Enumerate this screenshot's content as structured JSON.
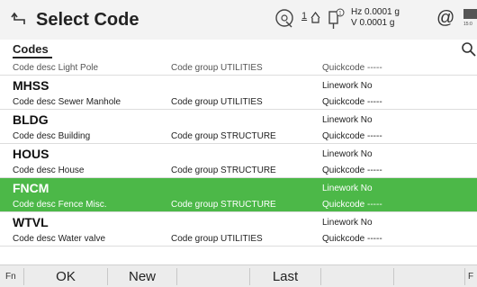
{
  "header": {
    "title": "Select Code",
    "target_label": "1",
    "hz_text": "Hz 0.0001 g",
    "v_text": "V  0.0001 g",
    "at_symbol": "@",
    "status_label": "15:0"
  },
  "tab": {
    "label": "Codes"
  },
  "rows": [
    {
      "code": "",
      "desc": "Code desc  Light Pole",
      "group": "Code group  UTILITIES",
      "linework": "",
      "quickcode": "Quickcode  -----"
    },
    {
      "code": "MHSS",
      "desc": "Code desc  Sewer Manhole",
      "group": "Code group  UTILITIES",
      "linework": "Linework  No",
      "quickcode": "Quickcode  -----"
    },
    {
      "code": "BLDG",
      "desc": "Code desc  Building",
      "group": "Code group  STRUCTURE",
      "linework": "Linework  No",
      "quickcode": "Quickcode  -----"
    },
    {
      "code": "HOUS",
      "desc": "Code desc  House",
      "group": "Code group  STRUCTURE",
      "linework": "Linework  No",
      "quickcode": "Quickcode  -----"
    },
    {
      "code": "FNCM",
      "desc": "Code desc  Fence Misc.",
      "group": "Code group  STRUCTURE",
      "linework": "Linework  No",
      "quickcode": "Quickcode  -----"
    },
    {
      "code": "WTVL",
      "desc": "Code desc  Water valve",
      "group": "Code group  UTILITIES",
      "linework": "Linework  No",
      "quickcode": "Quickcode  -----"
    }
  ],
  "bottombar": {
    "fn": "Fn",
    "ok": "OK",
    "new": "New",
    "last": "Last",
    "f": "F"
  },
  "colors": {
    "selected": "#4cb848",
    "header_bg": "#f3f3f3"
  },
  "icons": [
    "back-icon",
    "target-icon",
    "tilt-sensor-icon",
    "at-icon",
    "battery-icon",
    "search-icon"
  ]
}
